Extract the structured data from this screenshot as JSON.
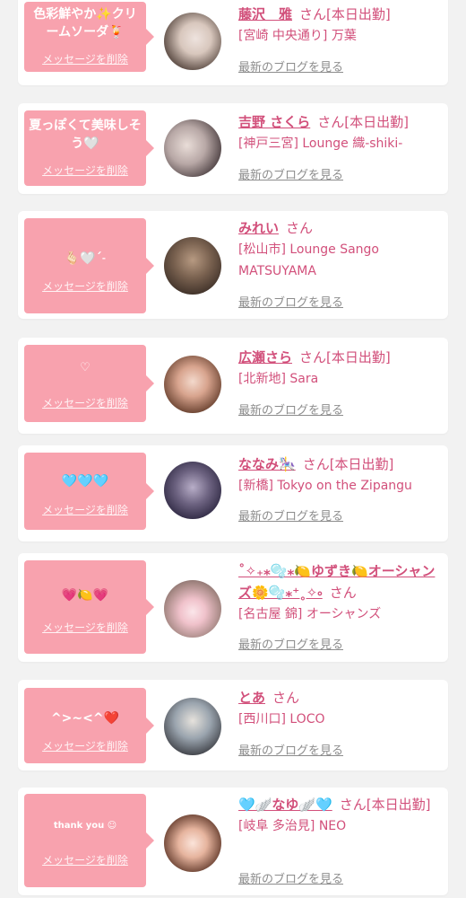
{
  "delete_label": "メッセージを削除",
  "blog_label": "最新のブログを見る",
  "san_label": "さん",
  "colors": {
    "accent": "#d2507b",
    "bubble": "#f8a2ae",
    "link": "#8d8d8d",
    "background": "#f2f2f2"
  },
  "cards": [
    {
      "message": "色彩鮮やか✨クリームソーダ🍹",
      "name": "藤沢　雅",
      "status": "[本日出勤]",
      "shop": "[宮崎 中央通り] 万葉"
    },
    {
      "message": "夏っぽくて美味しそう🤍",
      "name": "吉野 さくら",
      "status": "[本日出勤]",
      "shop": "[神戸三宮] Lounge 織-shiki-"
    },
    {
      "message": "🫰🏻🤍ˊ˗",
      "name": "みれい",
      "status": "",
      "shop": "[松山市] Lounge Sango MATSUYAMA"
    },
    {
      "message": "♡",
      "name": "広瀬さら",
      "status": "[本日出勤]",
      "shop": "[北新地] Sara"
    },
    {
      "message": "🩵🩵🩵",
      "name": "ななみ🎠",
      "status": "[本日出勤]",
      "shop": "[新橋] Tokyo on the Zipangu"
    },
    {
      "message": "💗🍋💗",
      "name": "˚✧₊⁎🫧⁎🍋ゆずき🍋オーシャンズ🌼🫧⁎⁺˳✧༚",
      "status": "",
      "shop": "[名古屋 錦] オーシャンズ"
    },
    {
      "message": "^>~<^❤️",
      "name": "とあ",
      "status": "",
      "shop": "[西川口] LOCO"
    },
    {
      "message": "thank you ☺︎",
      "name": "🩵🪽なゆ🪽🩵",
      "status": "[本日出勤]",
      "shop": "[岐阜 多治見] NEO"
    }
  ]
}
